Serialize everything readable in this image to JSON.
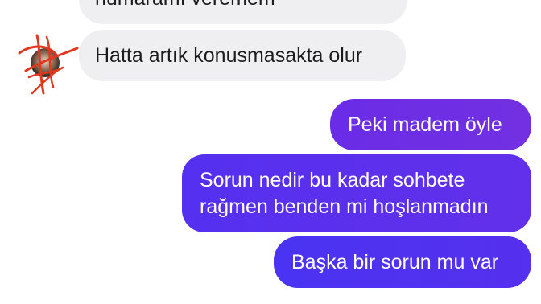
{
  "colors": {
    "incoming_bubble": "#efeff1",
    "incoming_text": "#1c1c1e",
    "outgoing_gradient_start": "#4a33f2",
    "outgoing_gradient_end": "#7230e2",
    "outgoing_text": "#ffffff",
    "avatar_scribble": "#e0381e"
  },
  "avatar": {
    "icon": "avatar-icon"
  },
  "messages": [
    {
      "direction": "incoming",
      "text": "numaramı veremem"
    },
    {
      "direction": "incoming",
      "text": "Hatta artık konusmasakta olur"
    },
    {
      "direction": "outgoing",
      "text": "Peki madem öyle"
    },
    {
      "direction": "outgoing",
      "lines": [
        "Sorun nedir bu kadar sohbete",
        "rağmen benden mi hoşlanmadın"
      ]
    },
    {
      "direction": "outgoing",
      "text": "Başka bir sorun mu var"
    }
  ]
}
